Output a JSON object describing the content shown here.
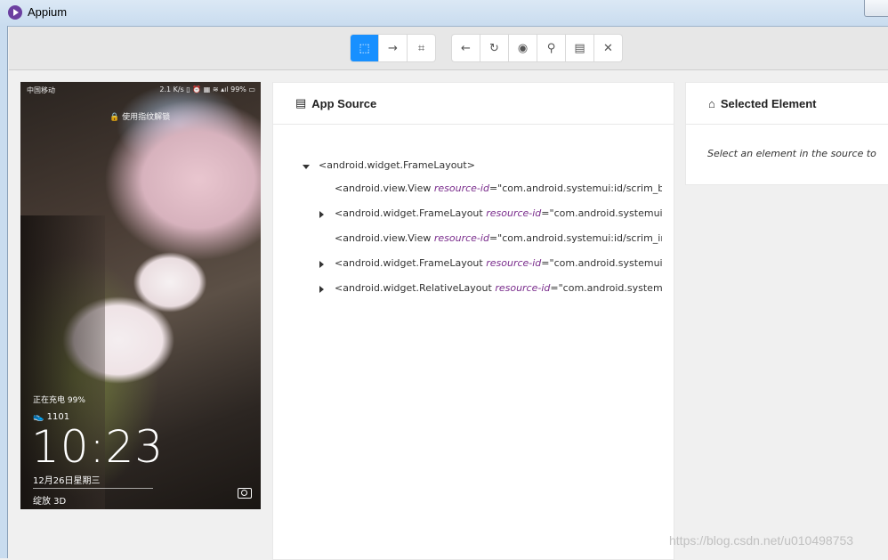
{
  "window": {
    "title": "Appium"
  },
  "toolbar": {
    "group1": [
      {
        "icon": "select-element-icon",
        "glyph": "⬚",
        "active": true
      },
      {
        "icon": "swipe-arrow-icon",
        "glyph": "→",
        "active": false
      },
      {
        "icon": "tap-coordinates-icon",
        "glyph": "⌗",
        "active": false
      }
    ],
    "group2": [
      {
        "icon": "back-arrow-icon",
        "glyph": "←"
      },
      {
        "icon": "refresh-icon",
        "glyph": "↻"
      },
      {
        "icon": "eye-icon",
        "glyph": "◉"
      },
      {
        "icon": "search-icon",
        "glyph": "⚲"
      },
      {
        "icon": "copy-xml-icon",
        "glyph": "▤"
      },
      {
        "icon": "close-icon",
        "glyph": "✕"
      }
    ]
  },
  "phone": {
    "carrier": "中国移动",
    "status_right": "2.1 K/s ▯ ⏰ ▦ ≋ ▴ıl 99% ▭",
    "unlock_hint": "🔒 使用指纹解锁",
    "charging": "正在充电 99%",
    "steps": "1101",
    "time": "10:23",
    "date": "12月26日星期三",
    "wallpaper_label": "绽放 3D"
  },
  "source": {
    "title": "App Source",
    "rows": [
      {
        "tag": "<android.widget.FrameLayout>",
        "attr": "",
        "val": "",
        "toggle": "open"
      },
      {
        "tag": "<android.view.View ",
        "attr": "resource-id",
        "val": "=\"com.android.systemui:id/scrim_behi",
        "toggle": "none"
      },
      {
        "tag": "<android.widget.FrameLayout ",
        "attr": "resource-id",
        "val": "=\"com.android.systemui:id/r",
        "toggle": "closed"
      },
      {
        "tag": "<android.view.View ",
        "attr": "resource-id",
        "val": "=\"com.android.systemui:id/scrim_in_fro",
        "toggle": "none"
      },
      {
        "tag": "<android.widget.FrameLayout ",
        "attr": "resource-id",
        "val": "=\"com.android.systemui:id/l",
        "toggle": "closed"
      },
      {
        "tag": "<android.widget.RelativeLayout ",
        "attr": "resource-id",
        "val": "=\"com.android.systemui:id",
        "toggle": "closed"
      }
    ]
  },
  "selected": {
    "title": "Selected Element",
    "hint": "Select an element in the source to begin"
  },
  "watermark": "https://blog.csdn.net/u010498753",
  "colors": {
    "accent": "#1890ff",
    "attr": "#7a2d8c"
  }
}
